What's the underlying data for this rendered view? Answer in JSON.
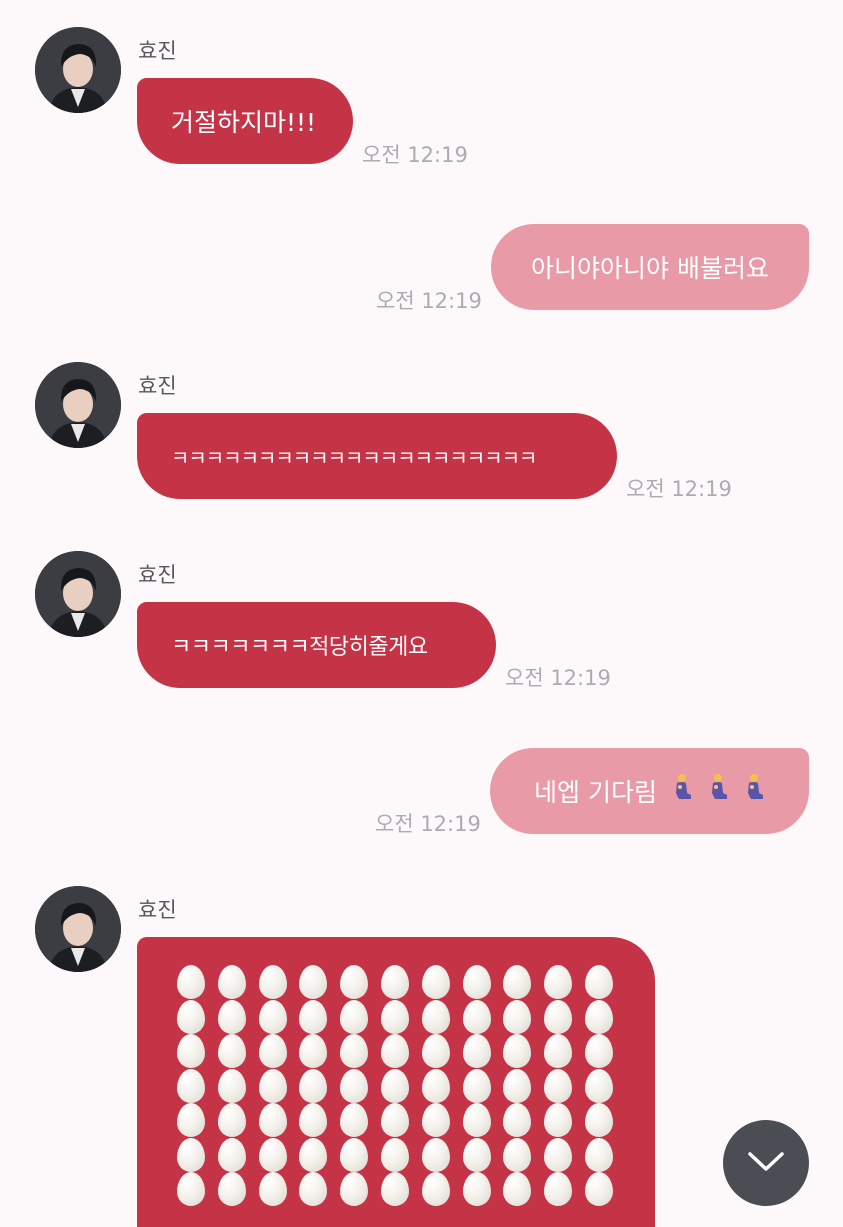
{
  "sender": {
    "name": "효진"
  },
  "messages": [
    {
      "side": "in",
      "text": "거절하지마!!!",
      "time": "오전 12:19"
    },
    {
      "side": "out",
      "text": "아니야아니야 배불러요",
      "time": "오전 12:19"
    },
    {
      "side": "in",
      "text": "ㅋㅋㅋㅋㅋㅋㅋㅋㅋㅋㅋㅋㅋㅋㅋㅋㅋㅋㅋㅋㅋ",
      "time": "오전 12:19"
    },
    {
      "side": "in",
      "text": "ㅋㅋㅋㅋㅋㅋㅋ적당히줄게요",
      "time": "오전 12:19"
    },
    {
      "side": "out",
      "text": "네엡 기다림",
      "emoji": [
        "kneeling-person-icon",
        "kneeling-person-icon",
        "kneeling-person-icon"
      ],
      "time": "오전 12:19"
    },
    {
      "side": "in",
      "content": "egg-emoji-grid",
      "emoji": "egg-icon"
    }
  ],
  "colors": {
    "incoming_bubble": "#c53346",
    "outgoing_bubble": "#e99aa7",
    "background": "#fdf8fa",
    "timestamp": "#aaacb2",
    "scroll_button": "#4a4d54"
  },
  "scroll_button": {
    "icon": "chevron-down-icon"
  }
}
